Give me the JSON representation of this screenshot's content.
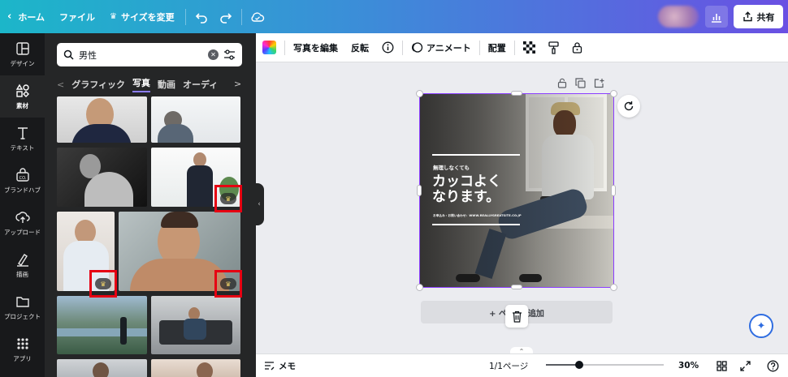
{
  "topbar": {
    "home_label": "ホーム",
    "file_label": "ファイル",
    "resize_label": "サイズを変更",
    "share_label": "共有"
  },
  "rail": {
    "items": [
      {
        "label": "デザイン",
        "icon": "layout-icon"
      },
      {
        "label": "素材",
        "icon": "elements-icon"
      },
      {
        "label": "テキスト",
        "icon": "text-icon"
      },
      {
        "label": "ブランドハブ",
        "icon": "brand-icon"
      },
      {
        "label": "アップロード",
        "icon": "upload-icon"
      },
      {
        "label": "描画",
        "icon": "draw-icon"
      },
      {
        "label": "プロジェクト",
        "icon": "folder-icon"
      },
      {
        "label": "アプリ",
        "icon": "apps-icon"
      }
    ],
    "active_index": 1
  },
  "panel": {
    "search_value": "男性",
    "tabs": [
      "グラフィック",
      "写真",
      "動画",
      "オーディ"
    ],
    "active_tab": "写真"
  },
  "context_toolbar": {
    "edit_photo": "写真を編集",
    "flip": "反転",
    "animate": "アニメート",
    "position": "配置"
  },
  "design": {
    "small_top": "無理しなくても",
    "headline": "カッコよく\nなります。",
    "small_bottom": "お申込み・お問い合わせ：WWW.REALLYGREATSITE.CO.JP"
  },
  "canvas": {
    "add_page_left": "+ ペ",
    "add_page_right": "追加"
  },
  "bottombar": {
    "notes_label": "メモ",
    "page_indicator": "1/1ページ",
    "zoom_label": "30%",
    "zoom_fraction": 0.28
  },
  "colors": {
    "accent": "#8b3dff",
    "highlight_box": "#e60012"
  }
}
